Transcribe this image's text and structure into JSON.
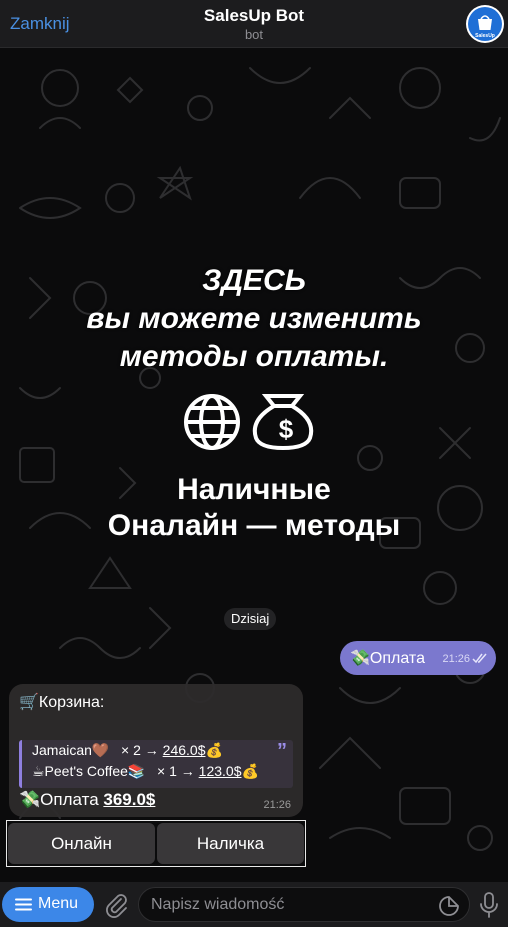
{
  "header": {
    "close_label": "Zamknij",
    "title": "SalesUp Bot",
    "subtitle": "bot",
    "avatar_text": "SalesUp"
  },
  "promo": {
    "lines": [
      "ЗДЕСЬ",
      "вы можете изменить",
      "методы оплаты."
    ],
    "icons": [
      "globe-icon",
      "money-bag-icon"
    ],
    "bold_lines": [
      "Наличные",
      "Оналайн — методы"
    ]
  },
  "chat": {
    "date": "Dzisiaj",
    "outgoing": {
      "text": "💸Оплата",
      "time": "21:26"
    },
    "incoming": {
      "title": "🛒Корзина:",
      "items": [
        {
          "name": "Jamaican🤎",
          "qty": "× 2 →",
          "price": "246.0$",
          "emoji": "💰"
        },
        {
          "name": "☕Peet's Coffee📚",
          "qty": "× 1 →",
          "price": "123.0$",
          "emoji": "💰"
        }
      ],
      "total_label": "💸Оплата",
      "total_value": "369.0$",
      "time": "21:26"
    }
  },
  "keyboard": {
    "online": "Онлайн",
    "cash": "Наличка"
  },
  "bottom": {
    "menu_label": "Menu",
    "placeholder": "Napisz wiadomość"
  },
  "colors": {
    "accent": "#3c87e8",
    "outgoing_bubble": "#7b78ce",
    "link": "#4a90e2"
  }
}
